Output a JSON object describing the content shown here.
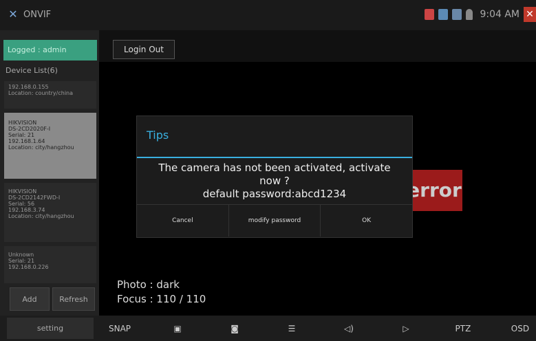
{
  "header": {
    "app_title": "ONVIF",
    "clock": "9:04 AM",
    "status_icons": [
      "battery-icon",
      "app-icon",
      "screenshot-icon",
      "lock-icon",
      "close-icon"
    ]
  },
  "sidebar": {
    "logged_label": "Logged : admin",
    "device_list_title": "Device List(6)",
    "devices": [
      {
        "lines": [
          "192.168.0.155",
          "Location: country/china"
        ]
      },
      {
        "lines": [
          "HIKVISION",
          "DS-2CD2020F-I",
          "Serial: 21",
          "192.168.1.64",
          "Location: city/hangzhou"
        ]
      },
      {
        "lines": [
          "HIKVISION",
          "DS-2CD2142FWD-I",
          "Serial: 56",
          "192.168.3.74",
          "Location: city/hangzhou"
        ]
      },
      {
        "lines": [
          "Unknown",
          "Serial: 21",
          "192.168.0.226"
        ]
      }
    ],
    "add_label": "Add",
    "refresh_label": "Refresh"
  },
  "topbar": {
    "logout_label": "Login Out"
  },
  "video": {
    "error_text": "error",
    "photo_line": "Photo : dark",
    "focus_line": "Focus : 110 / 110"
  },
  "dialog": {
    "title": "Tips",
    "message_line1": "The camera has not been activated, activate",
    "message_line2": "now ?",
    "message_line3": "default password:abcd1234",
    "buttons": {
      "cancel": "Cancel",
      "modify": "modify password",
      "ok": "OK"
    }
  },
  "bottom": {
    "setting_label": "setting",
    "tools": {
      "snap": "SNAP",
      "ptz": "PTZ",
      "osd": "OSD"
    }
  },
  "colors": {
    "accent": "#39b0e0",
    "logged_bg": "#3aa080",
    "error_bg": "#9b1b1b",
    "close_bg": "#c0392b"
  }
}
